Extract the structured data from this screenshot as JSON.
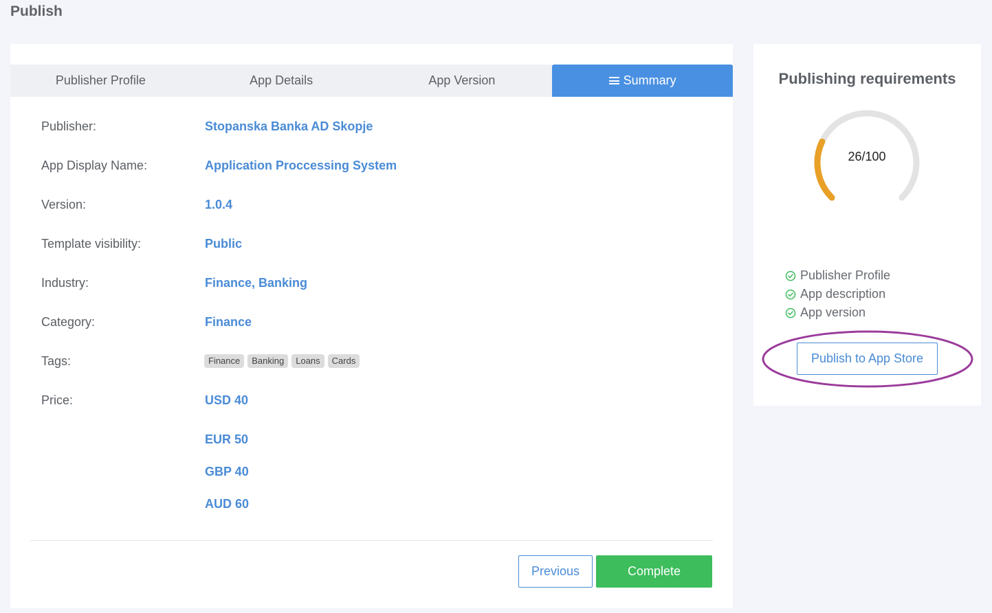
{
  "page": {
    "title": "Publish"
  },
  "tabs": [
    {
      "label": "Publisher Profile",
      "active": false
    },
    {
      "label": "App Details",
      "active": false
    },
    {
      "label": "App Version",
      "active": false
    },
    {
      "label": "Summary",
      "active": true,
      "icon": "list-icon"
    }
  ],
  "summary": {
    "publisher": {
      "label": "Publisher:",
      "value": "Stopanska Banka AD Skopje"
    },
    "app_name": {
      "label": "App Display Name:",
      "value": "Application Proccessing System"
    },
    "version": {
      "label": "Version:",
      "value": "1.0.4"
    },
    "visibility": {
      "label": "Template visibility:",
      "value": "Public"
    },
    "industry": {
      "label": "Industry:",
      "value": "Finance, Banking"
    },
    "category": {
      "label": "Category:",
      "value": "Finance"
    },
    "tags": {
      "label": "Tags:",
      "items": [
        "Finance",
        "Banking",
        "Loans",
        "Cards"
      ]
    },
    "price": {
      "label": "Price:",
      "values": [
        "USD 40",
        "EUR 50",
        "GBP 40",
        "AUD 60"
      ]
    }
  },
  "actions": {
    "previous_label": "Previous",
    "complete_label": "Complete"
  },
  "requirements": {
    "title": "Publishing requirements",
    "score_text": "26/100",
    "score": 26,
    "score_max": 100,
    "items": [
      "Publisher Profile",
      "App description",
      "App version"
    ],
    "publish_label": "Publish to App Store"
  },
  "colors": {
    "accent": "#4a90e2",
    "link": "#4a8bd6",
    "success": "#3dbd5c",
    "gauge_fill": "#e8a027",
    "gauge_track": "#e3e3e3",
    "check": "#3dbd5c",
    "highlight": "#9b3b9b"
  }
}
